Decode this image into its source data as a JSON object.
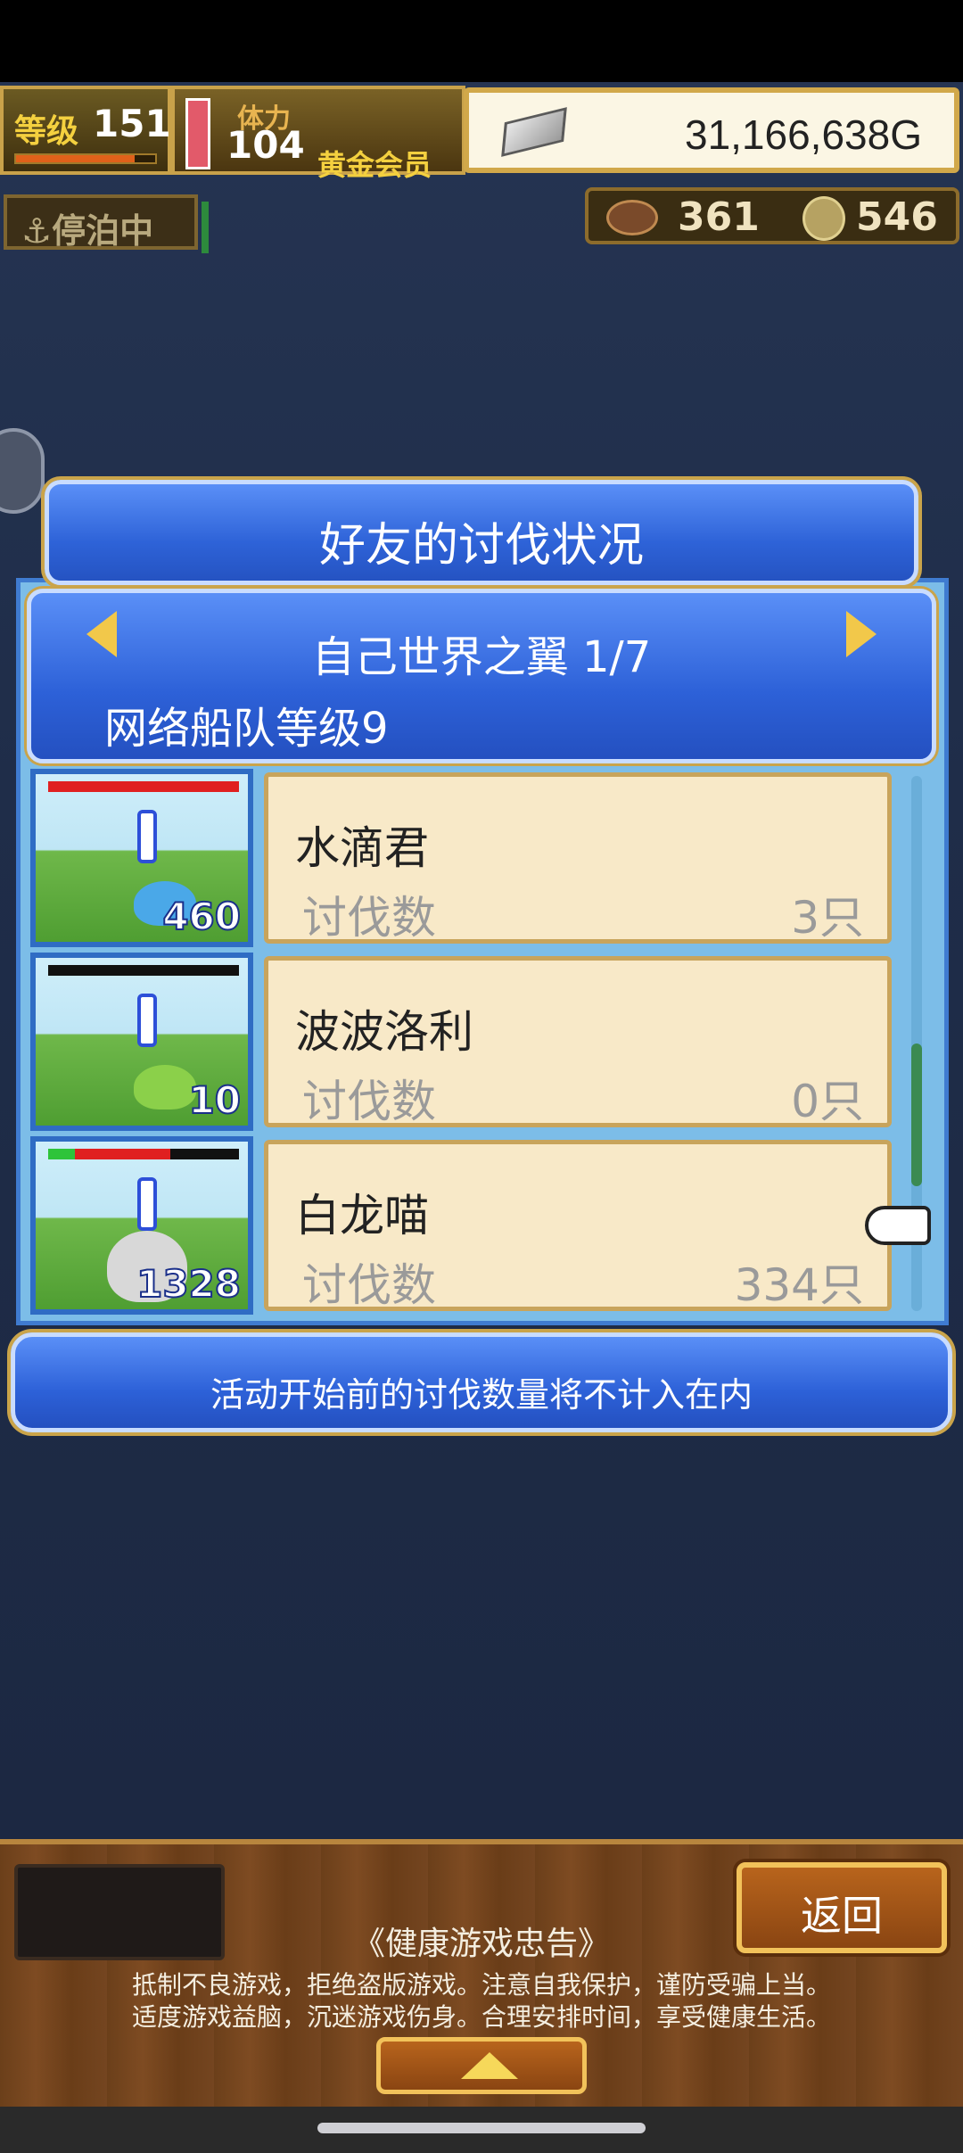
{
  "hud": {
    "level_label": "等级",
    "level_value": "151",
    "stamina_label": "体力",
    "stamina_value": "104",
    "membership": "黄金会员",
    "gold": "31,166,638G",
    "dock_status": "停泊中",
    "resource1": "361",
    "resource2": "546"
  },
  "panel": {
    "title": "好友的讨伐状况",
    "world_name": "自己世界之翼 1/7",
    "fleet_level": "网络船队等级9",
    "rows": [
      {
        "thumb_count": "460",
        "name": "水滴君",
        "label": "讨伐数",
        "count": "3只",
        "hp_color": "#e02020",
        "monster_color": "#4aa8e8"
      },
      {
        "thumb_count": "10",
        "name": "波波洛利",
        "label": "讨伐数",
        "count": "0只",
        "hp_color": "#111111",
        "monster_color": "#8bd04a"
      },
      {
        "thumb_count": "1328",
        "name": "白龙喵",
        "label": "讨伐数",
        "count": "334只",
        "hp_color": "#e02020",
        "monster_color": "#d8d8d8"
      }
    ],
    "notice": "活动开始前的讨伐数量将不计入在内"
  },
  "footer": {
    "back_label": "返回",
    "health_title": "《健康游戏忠告》",
    "health_line1": "抵制不良游戏，拒绝盗版游戏。注意自我保护，谨防受骗上当。",
    "health_line2": "适度游戏益脑，沉迷游戏伤身。合理安排时间，享受健康生活。"
  },
  "icons": [
    "anchor-icon",
    "silver-ingot-icon",
    "meat-icon",
    "coin-icon",
    "arrow-left-icon",
    "arrow-right-icon",
    "pointing-hand-icon",
    "up-arrow-icon"
  ]
}
